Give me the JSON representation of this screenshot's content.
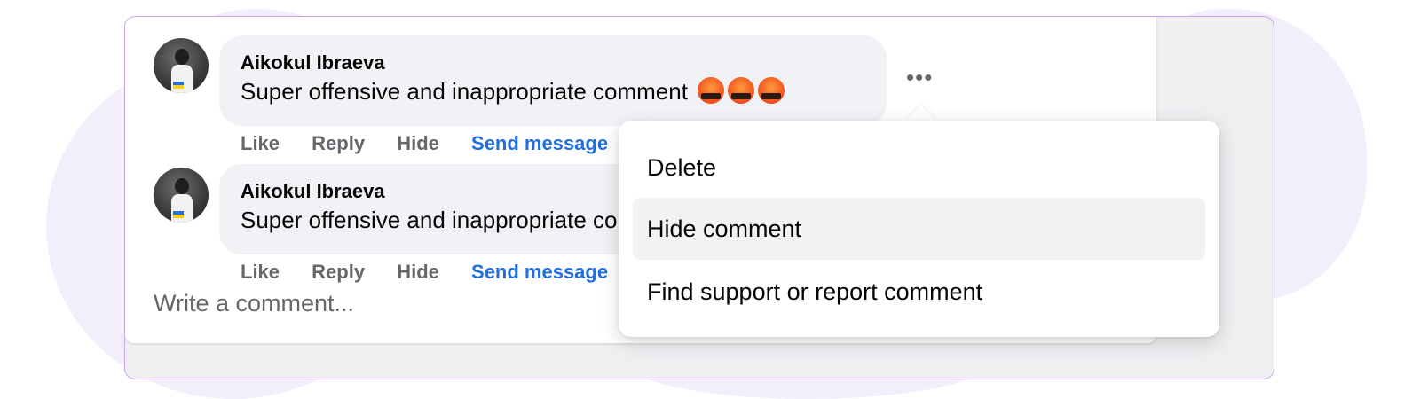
{
  "comments": [
    {
      "author": "Aikokul Ibraeva",
      "text": "Super offensive and inappropriate comment",
      "emoji_count": 3,
      "actions": {
        "like": "Like",
        "reply": "Reply",
        "hide": "Hide",
        "send": "Send message"
      }
    },
    {
      "author": "Aikokul Ibraeva",
      "text": "Super offensive and inappropriate comment",
      "actions": {
        "like": "Like",
        "reply": "Reply",
        "hide": "Hide",
        "send": "Send message"
      }
    }
  ],
  "more_button": "•••",
  "write_placeholder": "Write a comment...",
  "menu": {
    "items": [
      "Delete",
      "Hide comment",
      "Find support or report comment"
    ],
    "highlighted": "Hide comment"
  },
  "colors": {
    "accent_link": "#216fdb",
    "bubble": "#f0f2f5",
    "frame_border": "#c8a6ef",
    "blob": "#f3eefc"
  },
  "icons": {
    "emoji": "face-with-symbols-on-mouth-icon",
    "more": "more-options-icon"
  }
}
